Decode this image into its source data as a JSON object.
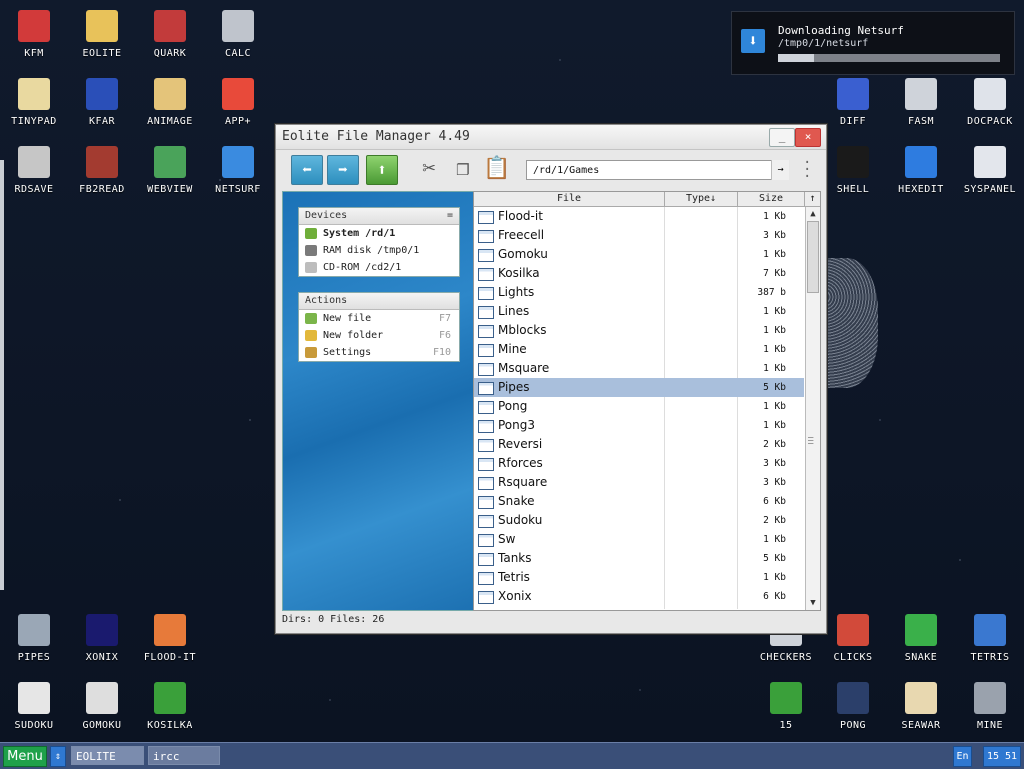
{
  "desktop_icons": [
    {
      "label": "KFM",
      "icon": "floppy-disk-icon",
      "color": "#d23a3a"
    },
    {
      "label": "EOLITE",
      "icon": "folder-icon",
      "color": "#e8c25a"
    },
    {
      "label": "QUARK",
      "icon": "book-icon",
      "color": "#c23b3b"
    },
    {
      "label": "CALC",
      "icon": "calculator-icon",
      "color": "#bfc4cc"
    },
    {
      "label": "TINYPAD",
      "icon": "notepad-icon",
      "color": "#e9d9a0"
    },
    {
      "label": "KFAR",
      "icon": "dual-panel-icon",
      "color": "#2a4fb8"
    },
    {
      "label": "ANIMAGE",
      "icon": "pencil-ruler-icon",
      "color": "#e4c47a"
    },
    {
      "label": "APP+",
      "icon": "rubik-cube-icon",
      "color": "#e84a3a"
    },
    {
      "label": "RDSAVE",
      "icon": "save-disk-icon",
      "color": "#c6c6c6"
    },
    {
      "label": "FB2READ",
      "icon": "fb2-book-icon",
      "color": "#a33b30"
    },
    {
      "label": "WEBVIEW",
      "icon": "web-image-icon",
      "color": "#4aa35a"
    },
    {
      "label": "NETSURF",
      "icon": "globe-icon",
      "color": "#3a8be0"
    },
    {
      "label": "DIFF",
      "icon": "diff-icon",
      "color": "#3a5fd0"
    },
    {
      "label": "FASM",
      "icon": "assembler-icon",
      "color": "#cfd3da"
    },
    {
      "label": "DOCPACK",
      "icon": "cabinet-icon",
      "color": "#dfe3ea"
    },
    {
      "label": "SHELL",
      "icon": "terminal-icon",
      "color": "#1a1a1a"
    },
    {
      "label": "HEXEDIT",
      "icon": "hex-icon",
      "color": "#2e7ce0"
    },
    {
      "label": "SYSPANEL",
      "icon": "sliders-icon",
      "color": "#e3e6ec"
    },
    {
      "label": "PIPES",
      "icon": "pipes-icon",
      "color": "#9aa7b6"
    },
    {
      "label": "XONIX",
      "icon": "xonix-icon",
      "color": "#1a1a6e"
    },
    {
      "label": "FLOOD-IT",
      "icon": "flood-grid-icon",
      "color": "#e77a3a"
    },
    {
      "label": "CHECKERS",
      "icon": "checkers-icon",
      "color": "#cfd3da"
    },
    {
      "label": "CLICKS",
      "icon": "blocks-icon",
      "color": "#d24a3a"
    },
    {
      "label": "SNAKE",
      "icon": "snake-icon",
      "color": "#3ab04a"
    },
    {
      "label": "TETRIS",
      "icon": "tetris-cube-icon",
      "color": "#3a78d0"
    },
    {
      "label": "SUDOKU",
      "icon": "sudoku-icon",
      "color": "#e6e6e6"
    },
    {
      "label": "GOMOKU",
      "icon": "gomoku-icon",
      "color": "#dedede"
    },
    {
      "label": "KOSILKA",
      "icon": "lawnmower-icon",
      "color": "#3aa03a"
    },
    {
      "label": "15",
      "icon": "fifteen-grid-icon",
      "color": "#3aa03a"
    },
    {
      "label": "PONG",
      "icon": "pong-icon",
      "color": "#2b3f6a"
    },
    {
      "label": "SEAWAR",
      "icon": "ship-icon",
      "color": "#e8d8b0"
    },
    {
      "label": "MINE",
      "icon": "mine-icon",
      "color": "#9aa2ad"
    }
  ],
  "notification": {
    "title": "Downloading Netsurf",
    "path": "/tmp0/1/netsurf",
    "progress": 0.16,
    "icon": "download-icon"
  },
  "window": {
    "title": "Eolite File Manager 4.49",
    "minimize_label": "_",
    "close_label": "×",
    "address": "/rd/1/Games",
    "address_go": "→",
    "status": "Dirs: 0  Files: 26",
    "devices": {
      "header": "Devices",
      "header_icon": "=",
      "items": [
        {
          "label": "System /rd/1",
          "icon": "system-icon"
        },
        {
          "label": "RAM disk /tmp0/1",
          "icon": "ram-disk-icon"
        },
        {
          "label": "CD-ROM /cd2/1",
          "icon": "cdrom-icon"
        }
      ]
    },
    "actions": {
      "header": "Actions",
      "items": [
        {
          "label": "New file",
          "key": "F7",
          "icon": "new-file-icon"
        },
        {
          "label": "New folder",
          "key": "F6",
          "icon": "new-folder-icon"
        },
        {
          "label": "Settings",
          "key": "F10",
          "icon": "settings-icon"
        }
      ]
    },
    "columns": {
      "file": "File",
      "type": "Type↓",
      "size": "Size",
      "sort": "↑"
    },
    "files": [
      {
        "name": "Flood-it",
        "size": "1 Kb"
      },
      {
        "name": "Freecell",
        "size": "3 Kb"
      },
      {
        "name": "Gomoku",
        "size": "1 Kb"
      },
      {
        "name": "Kosilka",
        "size": "7 Kb"
      },
      {
        "name": "Lights",
        "size": "387 b"
      },
      {
        "name": "Lines",
        "size": "1 Kb"
      },
      {
        "name": "Mblocks",
        "size": "1 Kb"
      },
      {
        "name": "Mine",
        "size": "1 Kb"
      },
      {
        "name": "Msquare",
        "size": "1 Kb"
      },
      {
        "name": "Pipes",
        "size": "5 Kb"
      },
      {
        "name": "Pong",
        "size": "1 Kb"
      },
      {
        "name": "Pong3",
        "size": "1 Kb"
      },
      {
        "name": "Reversi",
        "size": "2 Kb"
      },
      {
        "name": "Rforces",
        "size": "3 Kb"
      },
      {
        "name": "Rsquare",
        "size": "3 Kb"
      },
      {
        "name": "Snake",
        "size": "6 Kb"
      },
      {
        "name": "Sudoku",
        "size": "2 Kb"
      },
      {
        "name": "Sw",
        "size": "1 Kb"
      },
      {
        "name": "Tanks",
        "size": "5 Kb"
      },
      {
        "name": "Tetris",
        "size": "1 Kb"
      },
      {
        "name": "Xonix",
        "size": "6 Kb"
      }
    ],
    "selected_file": "Pipes"
  },
  "taskbar": {
    "menu_label": "Menu",
    "swap_label": "⇕",
    "tasks": [
      "EOLITE",
      "ircc"
    ],
    "lang": "En",
    "clock": "15 51"
  },
  "colors": {
    "accent": "#2f78d1",
    "selection": "#a9bfdc",
    "menu_green": "#1fa14a"
  }
}
